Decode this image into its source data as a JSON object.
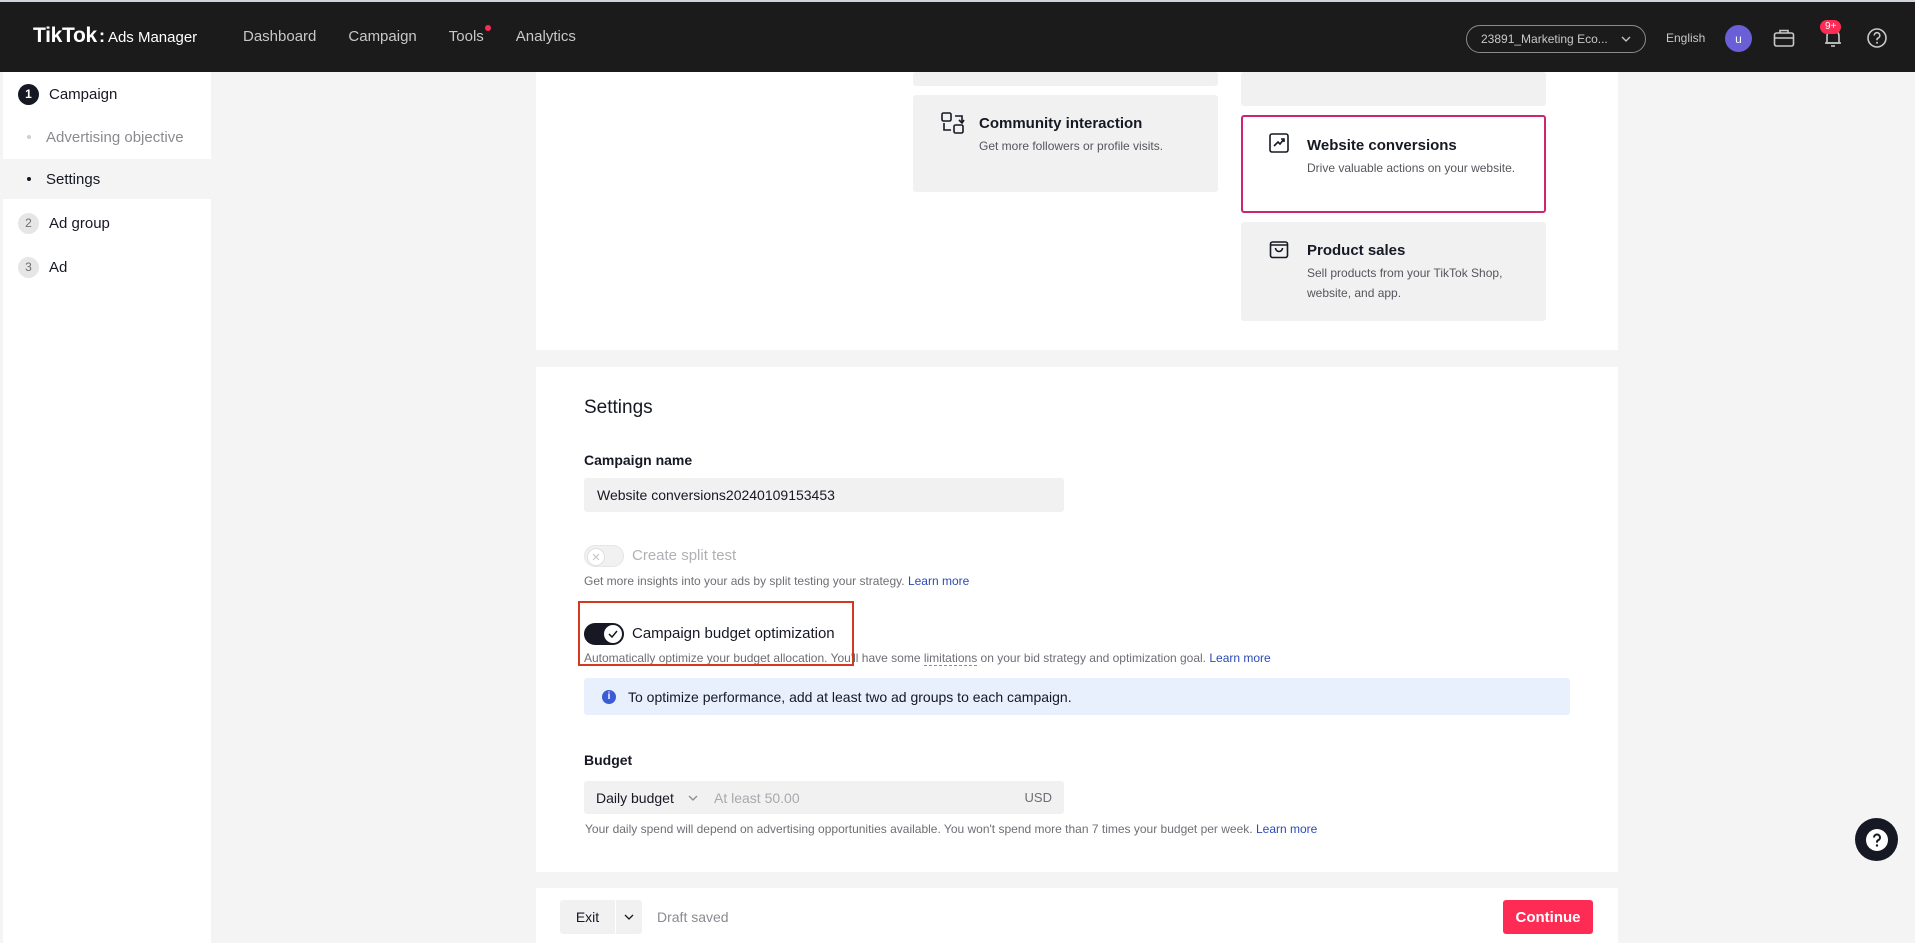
{
  "topbar": {
    "brand": "TikTok",
    "product": "Ads Manager",
    "nav": [
      {
        "label": "Dashboard"
      },
      {
        "label": "Campaign"
      },
      {
        "label": "Tools"
      },
      {
        "label": "Analytics"
      }
    ],
    "account": "23891_Marketing Eco...",
    "language": "English",
    "avatar_letter": "u",
    "notification_badge": "9+"
  },
  "sidebar": {
    "steps": [
      {
        "num": "1",
        "label": "Campaign"
      },
      {
        "num": "2",
        "label": "Ad group"
      },
      {
        "num": "3",
        "label": "Ad"
      }
    ],
    "substeps": [
      {
        "label": "Advertising objective"
      },
      {
        "label": "Settings"
      }
    ]
  },
  "objectives": {
    "community": {
      "title": "Community interaction",
      "desc": "Get more followers or profile visits."
    },
    "website": {
      "title": "Website conversions",
      "desc": "Drive valuable actions on your website."
    },
    "product": {
      "title": "Product sales",
      "desc": "Sell products from your TikTok Shop, website, and app."
    }
  },
  "settings": {
    "title": "Settings",
    "campaign_name_label": "Campaign name",
    "campaign_name_value": "Website conversions20240109153453",
    "split_test_label": "Create split test",
    "split_test_hint": "Get more insights into your ads by split testing your strategy.",
    "learn_more": "Learn more",
    "cbo_label": "Campaign budget optimization",
    "cbo_hint_pre": "Automatically optimize your budget allocation. You'll have some",
    "cbo_hint_link": "limitations",
    "cbo_hint_post": "on your bid strategy and optimization goal.",
    "info_banner": "To optimize performance, add at least two ad groups to each campaign.",
    "budget_label": "Budget",
    "budget_type": "Daily budget",
    "budget_placeholder": "At least 50.00",
    "budget_currency": "USD",
    "budget_hint": "Your daily spend will depend on advertising opportunities available. You won't spend more than 7 times your budget per week."
  },
  "footer": {
    "exit": "Exit",
    "draft_status": "Draft saved",
    "continue": "Continue"
  },
  "colors": {
    "accent": "#fe2c55",
    "selected_border": "#cc2572",
    "link": "#2a4bb5",
    "highlight": "#d3391f"
  }
}
